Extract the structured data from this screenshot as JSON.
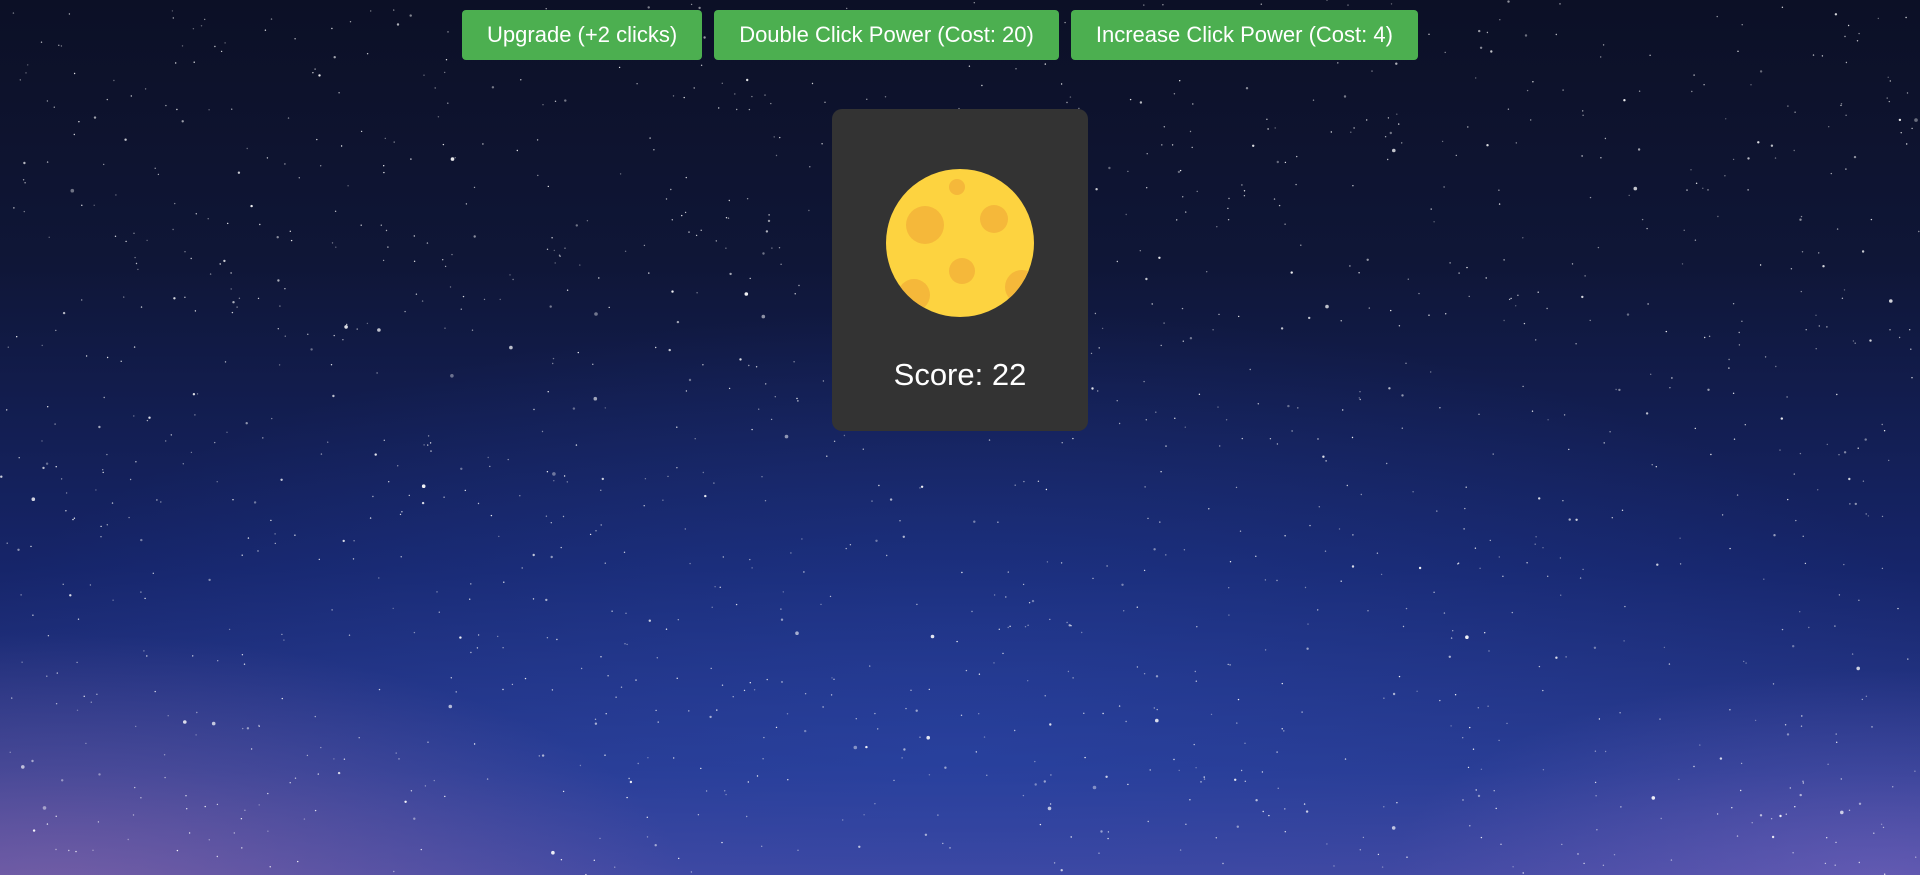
{
  "upgrades": {
    "upgrade_label": "Upgrade (+2 clicks)",
    "double_power_label": "Double Click Power (Cost: 20)",
    "increase_power_label": "Increase Click Power (Cost: 4)"
  },
  "game": {
    "clickable_icon": "moon-icon",
    "score_label": "Score: 22"
  },
  "colors": {
    "button_green": "#4caf50",
    "card_bg": "#333333",
    "moon_yellow": "#fdd340",
    "moon_crater": "#f5b83a"
  }
}
